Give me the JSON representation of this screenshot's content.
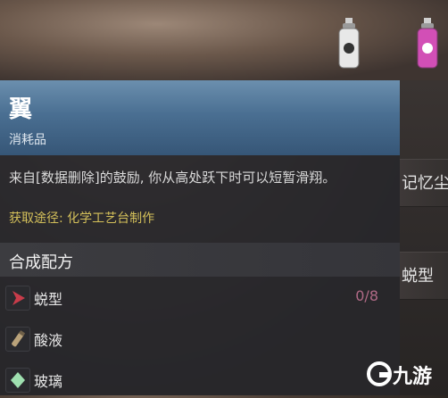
{
  "item": {
    "title": "翼",
    "type": "消耗品",
    "description": "来自[数据删除]的鼓励, 你从高处跃下时可以短暂滑翔。",
    "source": "获取途径: 化学工艺台制作"
  },
  "recipe": {
    "title": "合成配方",
    "ingredients": [
      {
        "name": "蜕型",
        "count": "0/8",
        "icon": "red-arrow-icon"
      },
      {
        "name": "酸液",
        "count": "",
        "icon": "acid-vial-icon"
      },
      {
        "name": "玻璃",
        "count": "",
        "icon": "glass-shard-icon"
      }
    ]
  },
  "side_list": {
    "items": [
      "记忆尘",
      "蜕型"
    ]
  },
  "watermark": {
    "text": "九游"
  },
  "colors": {
    "header_blue": "#4a6f92",
    "source_yellow": "#d4c05a",
    "count_pink": "#b06a86"
  }
}
